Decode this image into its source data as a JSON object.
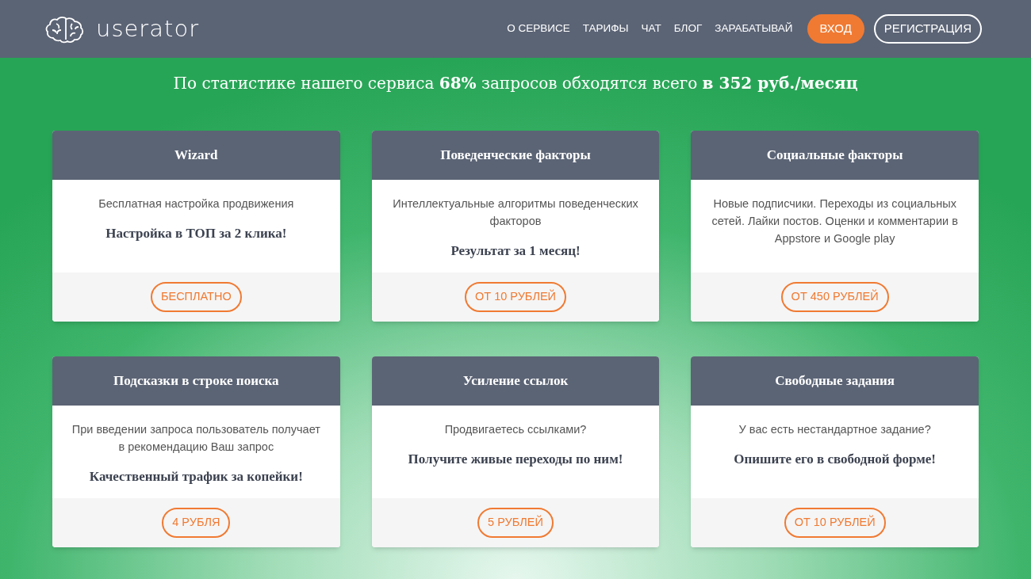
{
  "header": {
    "logo_text": "userator",
    "nav": [
      {
        "label": "О СЕРВИСЕ",
        "kind": "link"
      },
      {
        "label": "ТАРИФЫ",
        "kind": "link"
      },
      {
        "label": "ЧАТ",
        "kind": "link"
      },
      {
        "label": "БЛОГ",
        "kind": "link"
      },
      {
        "label": "ЗАРАБАТЫВАЙ",
        "kind": "link"
      },
      {
        "label": "ВХОД",
        "kind": "filled"
      },
      {
        "label": "РЕГИСТРАЦИЯ",
        "kind": "outline"
      }
    ]
  },
  "subtitle": "По статистике нашего сервиса **68%** запросов обходятся всего **в 352 руб./месяц**",
  "cards": [
    {
      "title": "Wizard",
      "description": "Бесплатная настройка продвижения",
      "highlight": "Настройка в ТОП за 2 клика!",
      "price": "БЕСПЛАТНО"
    },
    {
      "title": "Поведенческие факторы",
      "description": "Интеллектуальные алгоритмы поведенческих факторов",
      "highlight": "Результат за 1 месяц!",
      "price": "ОТ 10 РУБЛЕЙ"
    },
    {
      "title": "Социальные факторы",
      "description": "Новые подписчики. Переходы из социальных сетей. Лайки постов. Оценки и комментарии в Appstore и Google play",
      "price": "ОТ 450 РУБЛЕЙ"
    },
    {
      "title": "Подсказки в строке поиска",
      "description": "При введении запроса пользователь получает в рекомендацию Ваш запрос",
      "highlight": "Качественный трафик за копейки!",
      "price": "4 РУБЛЯ"
    },
    {
      "title": "Усиление ссылок",
      "description": "Продвигаетесь ссылками?",
      "highlight": "Получите живые переходы по ним!",
      "price": "5 РУБЛЕЙ"
    },
    {
      "title": "Свободные задания",
      "description": "У вас есть нестандартное задание?",
      "highlight": "Опишите его в свободной форме!",
      "price": "ОТ 10 РУБЛЕЙ"
    }
  ]
}
